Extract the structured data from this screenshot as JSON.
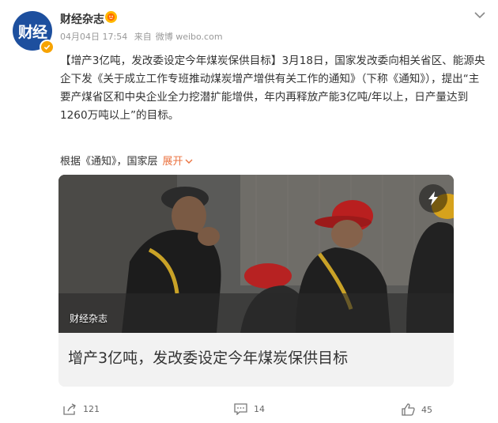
{
  "author": {
    "name": "财经杂志",
    "avatar_text": "财经",
    "avatar_color": "#1d4f9e",
    "verified_color": "#f7a300"
  },
  "meta": {
    "date": "04月04日 17:54",
    "source_label": "来自",
    "source": "微博 weibo.com"
  },
  "post": {
    "text": "【增产3亿吨，发改委设定今年煤炭保供目标】3月18日，国家发改委向相关省区、能源央企下发《关于成立工作专班推动煤炭增产增供有关工作的通知》（下称《通知》），提出“主要产煤省区和中央企业全力挖潜扩能增供，年内再释放产能3亿吨/年以上，日产量达到1260万吨以上”的目标。",
    "extra": "根据《通知》，国家层",
    "expand_label": "展开",
    "expand_color": "#eb7340"
  },
  "card": {
    "source_tag": "财经杂志",
    "title": "增产3亿吨，发改委设定今年煤炭保供目标"
  },
  "actions": {
    "share_count": "121",
    "comment_count": "14",
    "like_count": "45"
  }
}
